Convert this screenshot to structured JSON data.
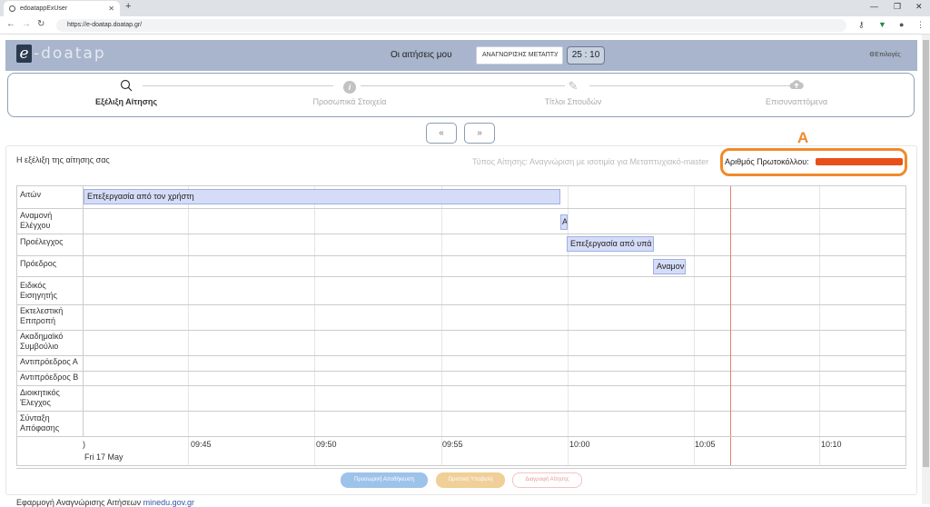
{
  "browser": {
    "tab_title": "edoatappExUser",
    "url": "https://e-doatap.doatap.gr/"
  },
  "header": {
    "logo_text": "-doatap",
    "my_applications_label": "Οι αιτήσεις μου",
    "selected_application": "ΑΝΑΓΝΩΡΙΣΗΣ ΜΕΤΑΠΤΥ",
    "timer": "25 : 10",
    "options_label": "Επιλογές"
  },
  "steps": [
    {
      "label": "Εξέλιξη Αίτησης",
      "icon": "search-icon",
      "active": true
    },
    {
      "label": "Προσωπικά Στοιχεία",
      "icon": "info-icon",
      "active": false
    },
    {
      "label": "Τίτλοι Σπουδών",
      "icon": "pencil-icon",
      "active": false
    },
    {
      "label": "Επισυναπτόμενα",
      "icon": "cloud-upload-icon",
      "active": false
    }
  ],
  "pager": {
    "prev": "«",
    "next": "»"
  },
  "panel": {
    "title": "Η εξέλιξη της αίτησης σας",
    "application_type": "Τύπος Αίτησης: Αναγνώριση με ισοτιμία για Μεταπτυχιακό-master",
    "protocol_label": "Αριθμός Πρωτοκόλλου:"
  },
  "annotation": {
    "letter": "A",
    "color": "#f08a2a"
  },
  "timeline": {
    "rows": [
      "Αιτών",
      "Αναμονή Ελέγχου",
      "Προέλεγχος",
      "Πρόεδρος",
      "Ειδικός Εισηγητής",
      "Εκτελεστική Επιτροπή",
      "Ακαδημαϊκό Συμβούλιο",
      "Αντιπρόεδρος Α",
      "Αντιπρόεδρος Β",
      "Διοικητικός Έλεγχος",
      "Σύνταξη Απόφασης"
    ],
    "ticks": [
      "09:45",
      "09:50",
      "09:55",
      "10:00",
      "10:05",
      "10:10"
    ],
    "first_tick_fragment": ")",
    "date": "Fri 17 May",
    "bars": [
      {
        "row": "Αιτών",
        "label": "Επεξεργασία από τον χρήστη"
      },
      {
        "row": "Αναμονή Ελέγχου",
        "label": "Α"
      },
      {
        "row": "Προέλεγχος",
        "label": "Επεξεργασία από υπά"
      },
      {
        "row": "Πρόεδρος",
        "label": "Αναμον"
      }
    ]
  },
  "actions": {
    "temp_save": "Προσωρινή Αποθήκευση",
    "final_submit": "Οριστική Υποβολή",
    "delete": "Διαγραφή Αίτησης"
  },
  "footer": {
    "text": "Εφαρμογή Αναγνώρισης Αιτήσεων",
    "link": "minedu.gov.gr"
  }
}
